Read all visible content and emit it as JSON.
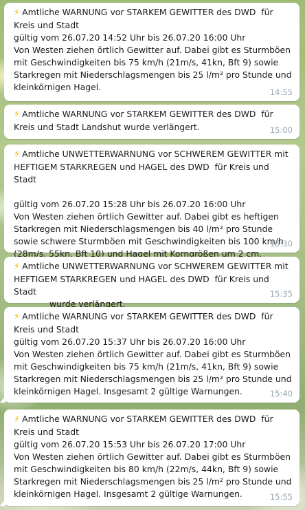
{
  "messages": [
    {
      "title": "Amtliche WARNUNG vor STARKEM GEWITTER des DWD  für Kreis und Stadt",
      "lines": [
        "gültig vom 26.07.20 14:52 Uhr bis 26.07.20 16:00 Uhr",
        "Von Westen ziehen örtlich Gewitter auf. Dabei gibt es Sturmböen mit Geschwindigkeiten bis 75 km/h (21m/s, 41kn, Bft 9) sowie Starkregen mit Niederschlagsmengen bis 25 l/m² pro Stunde und kleinkörnigen Hagel."
      ],
      "time": "14:55"
    },
    {
      "title": "Amtliche WARNUNG vor STARKEM GEWITTER des DWD  für Kreis und Stadt Landshut wurde verlängert.",
      "lines": [],
      "time": "15:00"
    },
    {
      "title": "Amtliche UNWETTERWARNUNG vor SCHWEREM GEWITTER mit HEFTIGEM STARKREGEN und HAGEL des DWD  für Kreis und Stadt",
      "lines": [
        "gültig vom 26.07.20 15:28 Uhr bis 26.07.20 16:00 Uhr",
        "Von Westen ziehen örtlich Gewitter auf. Dabei gibt es heftigen Starkregen mit Niederschlagsmengen bis 40 l/m² pro Stunde sowie schwere Sturmböen mit Geschwindigkeiten bis 100 km/h (28m/s, 55kn, Bft 10) und Hagel mit Korngrößen um 2 cm."
      ],
      "time": "15:30"
    },
    {
      "title": "Amtliche UNWETTERWARNUNG vor SCHWEREM GEWITTER mit HEFTIGEM STARKREGEN und HAGEL des DWD  für Kreis und Stadt",
      "lines": [
        "wurde verlängert."
      ],
      "time": "15:35"
    },
    {
      "title": "Amtliche WARNUNG vor STARKEM GEWITTER des DWD  für Kreis und Stadt",
      "lines": [
        "gültig vom 26.07.20 15:37 Uhr bis 26.07.20 16:00 Uhr",
        "Von Westen ziehen örtlich Gewitter auf. Dabei gibt es Sturmböen mit Geschwindigkeiten bis 75 km/h (21m/s, 41kn, Bft 9) sowie Starkregen mit Niederschlagsmengen bis 25 l/m² pro Stunde und kleinkörnigen Hagel. Insgesamt 2 gültige Warnungen."
      ],
      "time": "15:40"
    },
    {
      "title": "Amtliche WARNUNG vor STARKEM GEWITTER des DWD  für Kreis und Stadt",
      "lines": [
        "gültig vom 26.07.20 15:53 Uhr bis 26.07.20 17:00 Uhr",
        "Von Westen ziehen örtlich Gewitter auf. Dabei gibt es Sturmböen mit Geschwindigkeiten bis 80 km/h (22m/s, 44kn, Bft 9) sowie Starkregen mit Niederschlagsmengen bis 25 l/m² pro Stunde und kleinkörnigen Hagel. Insgesamt 2 gültige Warnungen."
      ],
      "time": "15:55"
    }
  ],
  "icons": {
    "warning": "lightning-bolt-icon"
  },
  "colors": {
    "bubble": "#ffffff",
    "time": "#9aa6b0",
    "bolt": "#f2b705"
  }
}
